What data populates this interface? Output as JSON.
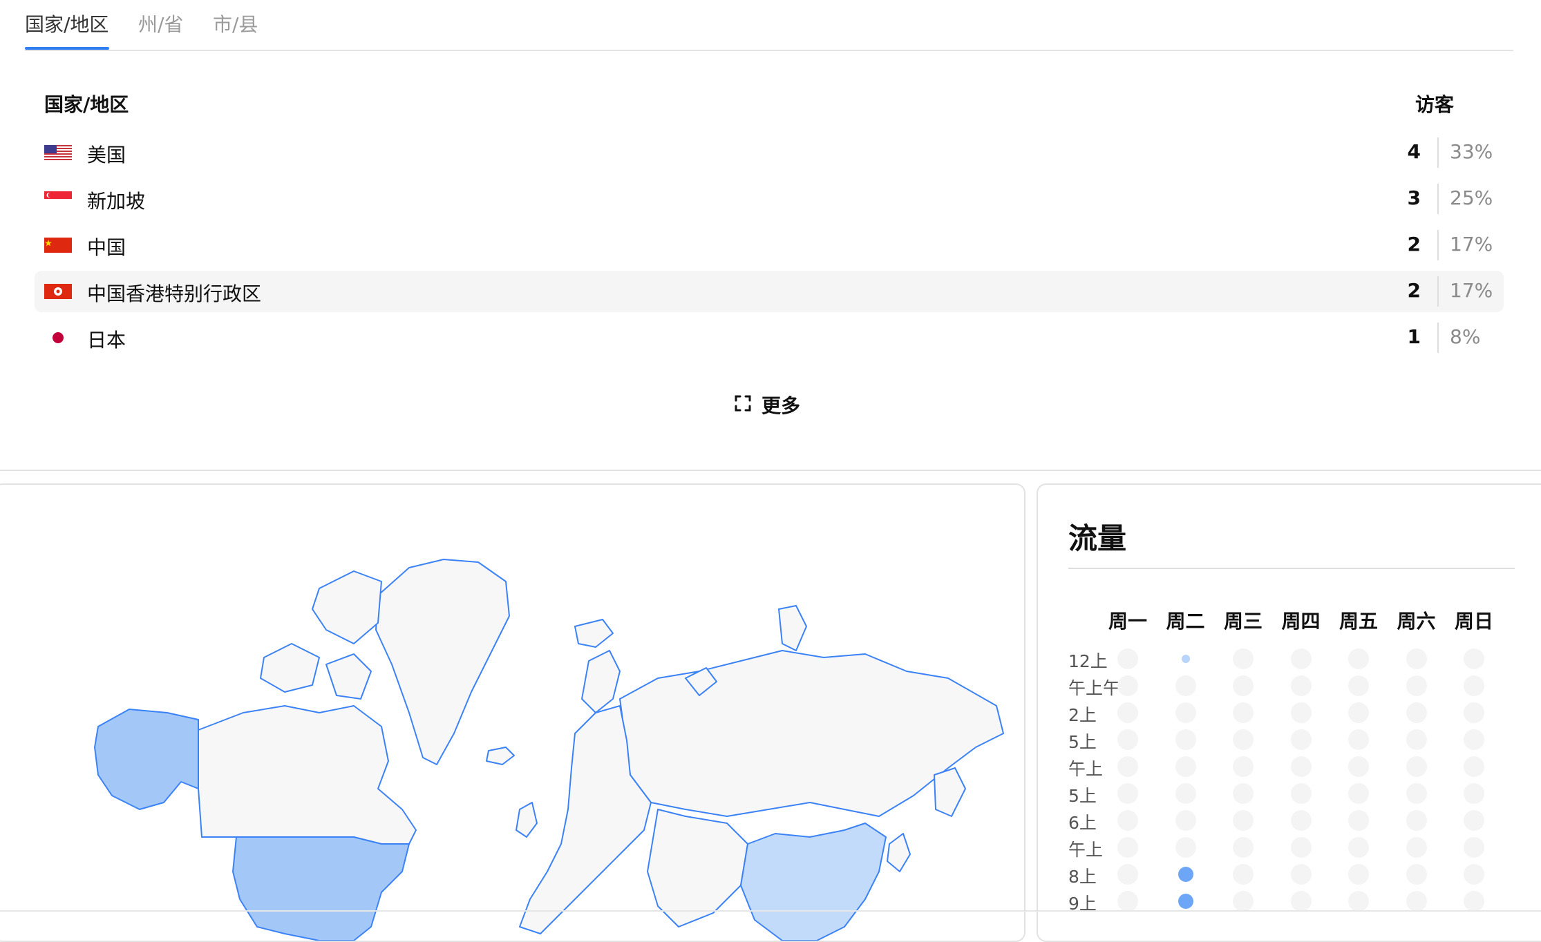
{
  "tabs": [
    {
      "label": "国家/地区",
      "active": true
    },
    {
      "label": "州/省",
      "active": false
    },
    {
      "label": "市/县",
      "active": false
    }
  ],
  "table": {
    "col_name": "国家/地区",
    "col_visitors": "访客",
    "rows": [
      {
        "name": "美国",
        "count": "4",
        "pct": "33%",
        "flag": "us-flag-icon",
        "highlight": false
      },
      {
        "name": "新加坡",
        "count": "3",
        "pct": "25%",
        "flag": "sg-flag-icon",
        "highlight": false
      },
      {
        "name": "中国",
        "count": "2",
        "pct": "17%",
        "flag": "cn-flag-icon",
        "highlight": false
      },
      {
        "name": "中国香港特别行政区",
        "count": "2",
        "pct": "17%",
        "flag": "hk-flag-icon",
        "highlight": true
      },
      {
        "name": "日本",
        "count": "1",
        "pct": "8%",
        "flag": "jp-flag-icon",
        "highlight": false
      }
    ],
    "more_label": "更多"
  },
  "map": {
    "highlight_color": "#a3c8f8",
    "highlight_light": "#c3dbfa",
    "border_color": "#3b82f6"
  },
  "traffic": {
    "title": "流量",
    "days": [
      "周一",
      "周二",
      "周三",
      "周四",
      "周五",
      "周六",
      "周日"
    ],
    "hours": [
      "12上",
      "午上午",
      "2上",
      "5上",
      "午上",
      "5上",
      "6上",
      "午上",
      "8上",
      "9上"
    ],
    "activity": [
      {
        "hour": 0,
        "day": 1,
        "level": "light"
      },
      {
        "hour": 8,
        "day": 1,
        "level": "mid"
      },
      {
        "hour": 9,
        "day": 1,
        "level": "mid"
      }
    ]
  },
  "colors": {
    "accent": "#2f7ff0"
  }
}
